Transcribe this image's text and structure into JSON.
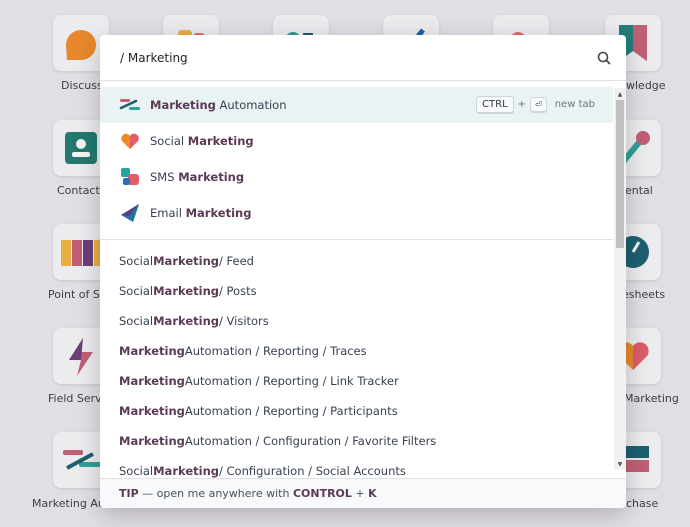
{
  "background_apps": [
    {
      "label": "Discuss"
    },
    {
      "label": "wledge"
    },
    {
      "label": "Contacts"
    },
    {
      "label": "ental"
    },
    {
      "label": "Point of Sa"
    },
    {
      "label": "esheets"
    },
    {
      "label": "Field Servi"
    },
    {
      "label": "Marketing"
    },
    {
      "label": "Marketing Au"
    },
    {
      "label": "chase"
    }
  ],
  "search": {
    "value": "/ Marketing",
    "icon": "search-icon"
  },
  "apps": [
    {
      "pre": "",
      "highlight": "Marketing",
      "post": " Automation",
      "icon": "marketing-automation-icon",
      "active": true
    },
    {
      "pre": "Social ",
      "highlight": "Marketing",
      "post": "",
      "icon": "social-marketing-icon",
      "active": false
    },
    {
      "pre": "SMS ",
      "highlight": "Marketing",
      "post": "",
      "icon": "sms-marketing-icon",
      "active": false
    },
    {
      "pre": "Email ",
      "highlight": "Marketing",
      "post": "",
      "icon": "email-marketing-icon",
      "active": false
    }
  ],
  "shortcut": {
    "key1": "CTRL",
    "plus": "+",
    "key2": "⏎",
    "label": "new tab"
  },
  "menus": [
    {
      "pre": "Social ",
      "highlight": "Marketing",
      "post": " / Feed"
    },
    {
      "pre": "Social ",
      "highlight": "Marketing",
      "post": " / Posts"
    },
    {
      "pre": "Social ",
      "highlight": "Marketing",
      "post": " / Visitors"
    },
    {
      "pre": "",
      "highlight": "Marketing",
      "post": " Automation / Reporting / Traces"
    },
    {
      "pre": "",
      "highlight": "Marketing",
      "post": " Automation / Reporting / Link Tracker"
    },
    {
      "pre": "",
      "highlight": "Marketing",
      "post": " Automation / Reporting / Participants"
    },
    {
      "pre": "",
      "highlight": "Marketing",
      "post": " Automation / Configuration / Favorite Filters"
    },
    {
      "pre": "Social ",
      "highlight": "Marketing",
      "post": " / Configuration / Social Accounts"
    }
  ],
  "footer": {
    "tip": "TIP",
    "text": " — open me anywhere with ",
    "key_control": "CONTROL",
    "plus": " + ",
    "key_k": "K"
  },
  "colors": {
    "highlight": "#5b3a55",
    "active_row": "#e9f3f3"
  }
}
